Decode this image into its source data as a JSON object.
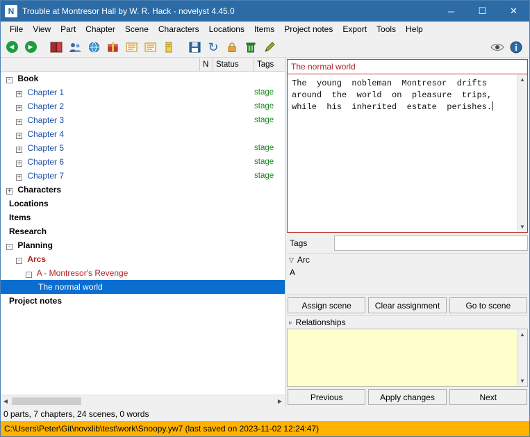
{
  "window": {
    "app_letter": "N",
    "title": "Trouble at Montresor Hall by W. R. Hack - novelyst 4.45.0",
    "minimize": "─",
    "maximize": "☐",
    "close": "✕"
  },
  "menubar": {
    "items": [
      {
        "label": "File"
      },
      {
        "label": "View"
      },
      {
        "label": "Part"
      },
      {
        "label": "Chapter"
      },
      {
        "label": "Scene"
      },
      {
        "label": "Characters"
      },
      {
        "label": "Locations"
      },
      {
        "label": "Items"
      },
      {
        "label": "Project notes"
      },
      {
        "label": "Export"
      },
      {
        "label": "Tools"
      },
      {
        "label": "Help"
      }
    ]
  },
  "toolbar": {
    "buttons": [
      {
        "name": "go-back-button",
        "icon": "left-arrow-circle-icon",
        "color": "#1b9e3e",
        "glyph": "◀"
      },
      {
        "name": "go-forward-button",
        "icon": "right-arrow-circle-icon",
        "color": "#1b9e3e",
        "glyph": "▶"
      },
      {
        "name": "view-book-button",
        "icon": "book-icon",
        "color": "#a82c2c",
        "glyph": ""
      },
      {
        "name": "view-characters-button",
        "icon": "characters-icon",
        "color": "#3a6ea5",
        "glyph": ""
      },
      {
        "name": "view-locations-button",
        "icon": "globe-icon",
        "color": "#3a9ad9",
        "glyph": ""
      },
      {
        "name": "view-items-button",
        "icon": "items-box-icon",
        "color": "#c0392b",
        "glyph": ""
      },
      {
        "name": "view-research-button",
        "icon": "list-icon",
        "color": "#e8a33d",
        "glyph": ""
      },
      {
        "name": "view-planning-button",
        "icon": "list2-icon",
        "color": "#e8a33d",
        "glyph": ""
      },
      {
        "name": "view-notes-button",
        "icon": "note-icon",
        "color": "#e8c23d",
        "glyph": ""
      },
      {
        "name": "save-button",
        "icon": "save-disk-icon",
        "color": "#2c6ba5",
        "glyph": ""
      },
      {
        "name": "reload-button",
        "icon": "reload-icon",
        "color": "#2c6ba5",
        "glyph": "↻"
      },
      {
        "name": "lock-button",
        "icon": "lock-icon",
        "color": "#e8a33d",
        "glyph": ""
      },
      {
        "name": "delete-button",
        "icon": "trash-icon",
        "color": "#3a9a3a",
        "glyph": ""
      },
      {
        "name": "edit-button",
        "icon": "pencil-icon",
        "color": "#8a9a2c",
        "glyph": ""
      }
    ],
    "right_buttons": [
      {
        "name": "toggle-viewer-button",
        "icon": "eye-icon",
        "color": "#5a5a5a",
        "glyph": "◉"
      },
      {
        "name": "properties-button",
        "icon": "info-icon",
        "color": "#2c6ba5",
        "glyph": "i"
      }
    ]
  },
  "tree": {
    "headers": {
      "title": "",
      "n": "N",
      "status": "Status",
      "tags": "Tags"
    },
    "rows": [
      {
        "label": "Book",
        "level": 0,
        "expander": "-",
        "style": "bold c-black",
        "tag": ""
      },
      {
        "label": "Chapter 1",
        "level": 1,
        "expander": "+",
        "style": "c-blue",
        "tag": "stage"
      },
      {
        "label": "Chapter 2",
        "level": 1,
        "expander": "+",
        "style": "c-blue",
        "tag": "stage"
      },
      {
        "label": "Chapter 3",
        "level": 1,
        "expander": "+",
        "style": "c-blue",
        "tag": "stage"
      },
      {
        "label": "Chapter 4",
        "level": 1,
        "expander": "+",
        "style": "c-blue",
        "tag": ""
      },
      {
        "label": "Chapter 5",
        "level": 1,
        "expander": "+",
        "style": "c-blue",
        "tag": "stage"
      },
      {
        "label": "Chapter 6",
        "level": 1,
        "expander": "+",
        "style": "c-blue",
        "tag": "stage"
      },
      {
        "label": "Chapter 7",
        "level": 1,
        "expander": "+",
        "style": "c-blue",
        "tag": "stage"
      },
      {
        "label": "Characters",
        "level": 0,
        "expander": "+",
        "style": "bold c-black",
        "tag": ""
      },
      {
        "label": "Locations",
        "level": 0,
        "expander": "",
        "style": "bold c-black",
        "tag": ""
      },
      {
        "label": "Items",
        "level": 0,
        "expander": "",
        "style": "bold c-black",
        "tag": ""
      },
      {
        "label": "Research",
        "level": 0,
        "expander": "",
        "style": "bold c-black",
        "tag": ""
      },
      {
        "label": "Planning",
        "level": 0,
        "expander": "-",
        "style": "bold c-black",
        "tag": ""
      },
      {
        "label": "Arcs",
        "level": 1,
        "expander": "-",
        "style": "bold c-red",
        "tag": ""
      },
      {
        "label": "A - Montresor's Revenge",
        "level": 2,
        "expander": "-",
        "style": "c-red",
        "tag": ""
      },
      {
        "label": "The normal world",
        "level": 3,
        "expander": "",
        "style": "c-black",
        "tag": "",
        "selected": true
      },
      {
        "label": "Project notes",
        "level": 0,
        "expander": "",
        "style": "bold c-black",
        "tag": ""
      }
    ],
    "hscroll_left_arrow": "◀",
    "hscroll_right_arrow": "▶"
  },
  "editor": {
    "title_value": "The normal world",
    "description": "The  young  nobleman  Montresor  drifts\naround  the  world  on  pleasure  trips,\nwhile  his  inherited  estate  perishes.",
    "scroll_up": "▲",
    "scroll_down": "▼"
  },
  "tags": {
    "label": "Tags",
    "value": ""
  },
  "arc_section": {
    "header": "Arc",
    "triangle": "▽",
    "value": "A",
    "buttons": [
      {
        "label": "Assign scene",
        "name": "assign-scene-button"
      },
      {
        "label": "Clear assignment",
        "name": "clear-assignment-button"
      },
      {
        "label": "Go to scene",
        "name": "go-to-scene-button"
      }
    ]
  },
  "relationships_section": {
    "header": "Relationships",
    "triangle": "▹",
    "note_value": "",
    "buttons": [
      {
        "label": "Previous",
        "name": "previous-button"
      },
      {
        "label": "Apply changes",
        "name": "apply-changes-button"
      },
      {
        "label": "Next",
        "name": "next-button"
      }
    ]
  },
  "statusbar": {
    "text": "0 parts, 7 chapters, 24 scenes, 0 words"
  },
  "pathbar": {
    "text": "C:\\Users\\Peter\\Git\\novxlib\\test\\work\\Snoopy.yw7 (last saved on 2023-11-02 12:24:47)",
    "color": "#ffb300"
  }
}
